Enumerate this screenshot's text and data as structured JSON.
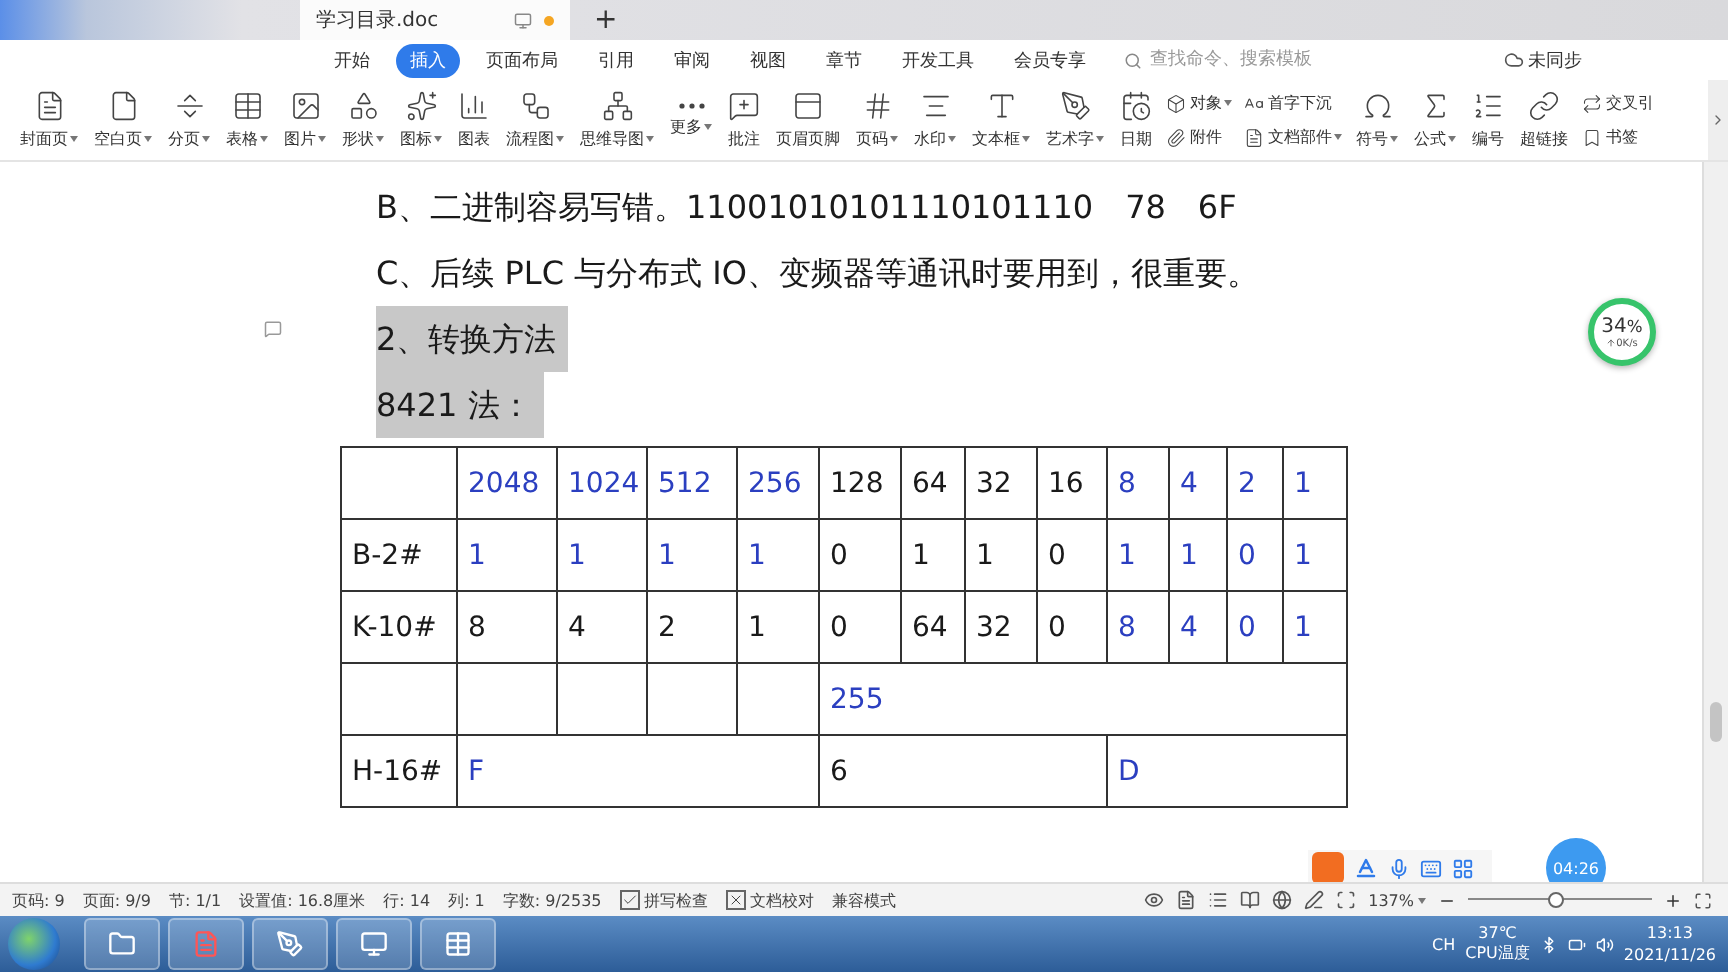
{
  "tab_bar": {
    "doc_tab": {
      "title": "学习目录.doc",
      "unsaved": true
    },
    "new_tab": "+"
  },
  "ribbon": {
    "tabs": [
      {
        "label": "开始",
        "selected": false
      },
      {
        "label": "插入",
        "selected": true
      },
      {
        "label": "页面布局",
        "selected": false
      },
      {
        "label": "引用",
        "selected": false
      },
      {
        "label": "审阅",
        "selected": false
      },
      {
        "label": "视图",
        "selected": false
      },
      {
        "label": "章节",
        "selected": false
      },
      {
        "label": "开发工具",
        "selected": false
      },
      {
        "label": "会员专享",
        "selected": false
      }
    ],
    "search": {
      "placeholder": "查找命令、搜索模板"
    },
    "sync": "未同步"
  },
  "toolbar": [
    {
      "kind": "large",
      "label": "封面页",
      "dropdown": true
    },
    {
      "kind": "large",
      "label": "空白页",
      "dropdown": true
    },
    {
      "kind": "large",
      "label": "分页",
      "dropdown": true
    },
    {
      "kind": "large",
      "label": "表格",
      "dropdown": true
    },
    {
      "kind": "large",
      "label": "图片",
      "dropdown": true
    },
    {
      "kind": "large",
      "label": "形状",
      "dropdown": true
    },
    {
      "kind": "large",
      "label": "图标",
      "dropdown": true
    },
    {
      "kind": "large",
      "label": "图表",
      "dropdown": false
    },
    {
      "kind": "large",
      "label": "流程图",
      "dropdown": true
    },
    {
      "kind": "large",
      "label": "思维导图",
      "dropdown": true
    },
    {
      "kind": "large",
      "label": "更多",
      "dropdown": true
    },
    {
      "kind": "large",
      "label": "批注",
      "dropdown": false
    },
    {
      "kind": "large",
      "label": "页眉页脚",
      "dropdown": false
    },
    {
      "kind": "large",
      "label": "页码",
      "dropdown": true
    },
    {
      "kind": "large",
      "label": "水印",
      "dropdown": true
    },
    {
      "kind": "large",
      "label": "文本框",
      "dropdown": true
    },
    {
      "kind": "large",
      "label": "艺术字",
      "dropdown": true
    },
    {
      "kind": "large",
      "label": "日期",
      "dropdown": false
    },
    {
      "kind": "stack",
      "entries": [
        {
          "label": "对象",
          "dropdown": true
        },
        {
          "label": "附件",
          "dropdown": false
        }
      ]
    },
    {
      "kind": "stack",
      "entries": [
        {
          "label": "首字下沉",
          "dropdown": false
        },
        {
          "label": "文档部件",
          "dropdown": true
        }
      ]
    },
    {
      "kind": "large",
      "label": "符号",
      "dropdown": true
    },
    {
      "kind": "large",
      "label": "公式",
      "dropdown": true
    },
    {
      "kind": "large",
      "label": "编号",
      "dropdown": false
    },
    {
      "kind": "large",
      "label": "超链接",
      "dropdown": false
    },
    {
      "kind": "stack",
      "entries": [
        {
          "label": "交叉引",
          "dropdown": false
        },
        {
          "label": "书签",
          "dropdown": false
        }
      ]
    }
  ],
  "document": {
    "paragraphs": [
      {
        "text": "B、二进制容易写错。11001010101110101110　78　6F",
        "highlighted": false
      },
      {
        "text": "C、后续 PLC 与分布式 IO、变频器等通讯时要用到，很重要。",
        "highlighted": false
      },
      {
        "text": "2、转换方法",
        "highlighted": true
      },
      {
        "text": "8421 法：",
        "highlighted": true
      }
    ],
    "table": {
      "rows": [
        [
          null,
          {
            "text": "2048",
            "color": "#2b3fc0"
          },
          {
            "text": "1024",
            "color": "#2b3fc0"
          },
          {
            "text": "512",
            "color": "#2b3fc0"
          },
          {
            "text": "256",
            "color": "#2b3fc0"
          },
          {
            "text": "128",
            "color": "#1a1a1a"
          },
          {
            "text": "64",
            "color": "#1a1a1a"
          },
          {
            "text": "32",
            "color": "#1a1a1a"
          },
          {
            "text": "16",
            "color": "#1a1a1a"
          },
          {
            "text": "8",
            "color": "#2b3fc0"
          },
          {
            "text": "4",
            "color": "#2b3fc0"
          },
          {
            "text": "2",
            "color": "#2b3fc0"
          },
          {
            "text": "1",
            "color": "#2b3fc0"
          }
        ],
        [
          {
            "text": "B-2#",
            "color": "#1a1a1a"
          },
          {
            "text": "1",
            "color": "#2b3fc0"
          },
          {
            "text": "1",
            "color": "#2b3fc0"
          },
          {
            "text": "1",
            "color": "#2b3fc0"
          },
          {
            "text": "1",
            "color": "#2b3fc0"
          },
          {
            "text": "0",
            "color": "#1a1a1a"
          },
          {
            "text": "1",
            "color": "#1a1a1a"
          },
          {
            "text": "1",
            "color": "#1a1a1a"
          },
          {
            "text": "0",
            "color": "#1a1a1a"
          },
          {
            "text": "1",
            "color": "#2b3fc0"
          },
          {
            "text": "1",
            "color": "#2b3fc0"
          },
          {
            "text": "0",
            "color": "#2b3fc0"
          },
          {
            "text": "1",
            "color": "#2b3fc0"
          }
        ],
        [
          {
            "text": "K-10#",
            "color": "#1a1a1a"
          },
          {
            "text": "8",
            "color": "#1a1a1a"
          },
          {
            "text": "4",
            "color": "#1a1a1a"
          },
          {
            "text": "2",
            "color": "#1a1a1a"
          },
          {
            "text": "1",
            "color": "#1a1a1a"
          },
          {
            "text": "0",
            "color": "#1a1a1a"
          },
          {
            "text": "64",
            "color": "#1a1a1a"
          },
          {
            "text": "32",
            "color": "#1a1a1a"
          },
          {
            "text": "0",
            "color": "#1a1a1a"
          },
          {
            "text": "8",
            "color": "#2b3fc0"
          },
          {
            "text": "4",
            "color": "#2b3fc0"
          },
          {
            "text": "0",
            "color": "#2b3fc0"
          },
          {
            "text": "1",
            "color": "#2b3fc0"
          }
        ],
        [
          null,
          null,
          null,
          null,
          null,
          {
            "text": "255",
            "color": "#2b3fc0",
            "colspan": 8
          }
        ],
        [
          {
            "text": "H-16#",
            "color": "#1a1a1a"
          },
          {
            "text": "F",
            "color": "#2b3fc0",
            "colspan": 4
          },
          {
            "text": "6",
            "color": "#1a1a1a",
            "colspan": 4
          },
          {
            "text": "D",
            "color": "#2b3fc0",
            "colspan": 4
          }
        ]
      ]
    }
  },
  "net_meter": {
    "percent": "34",
    "unit": "%",
    "speed": "0K/s"
  },
  "timer_bubble": "04:26",
  "status_bar": {
    "items": [
      "页码: 9",
      "页面: 9/9",
      "节: 1/1",
      "设置值: 16.8厘米",
      "行: 14",
      "列: 1",
      "字数: 9/2535"
    ],
    "checks": [
      {
        "label": "拼写检查",
        "kind": "tick"
      },
      {
        "label": "文档校对",
        "kind": "cross"
      }
    ],
    "mode": "兼容模式",
    "zoom": "137%",
    "zoom_slider": {
      "level": 0.48
    }
  },
  "taskbar": {
    "ime": "CH",
    "temp": "37℃",
    "temp_label": "CPU温度",
    "time": "13:13",
    "date": "2021/11/26"
  }
}
